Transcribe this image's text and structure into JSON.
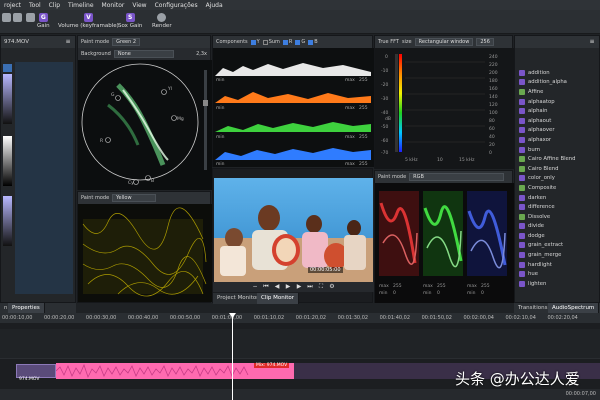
{
  "menu": [
    "roject",
    "Tool",
    "Clip",
    "Timeline",
    "Monitor",
    "View",
    "Configurações",
    "Ajuda"
  ],
  "toolbar": {
    "items": [
      {
        "label": "Gain",
        "badge": "G"
      },
      {
        "label": "Volume (keyframable)",
        "badge": "V"
      },
      {
        "label": "Sox Gain",
        "badge": "S"
      },
      {
        "label": "Render",
        "badge": ""
      }
    ]
  },
  "left_panel": {
    "title": "974.MOV",
    "tab_a": "n",
    "tab_b": "Properties"
  },
  "vectorscope": {
    "paint_mode_label": "Paint mode",
    "paint_mode_value": "Green 2",
    "background_label": "Background",
    "background_value": "None",
    "zoom": "2,3x",
    "targets": [
      "R",
      "Mg",
      "Yl",
      "B",
      "G",
      "Cy"
    ]
  },
  "waveform": {
    "paint_mode_label": "Paint mode",
    "paint_mode_value": "Yellow"
  },
  "histogram": {
    "title": "Components",
    "options": [
      {
        "label": "Y",
        "checked": true
      },
      {
        "label": "Sum",
        "checked": false
      },
      {
        "label": "R",
        "checked": true
      },
      {
        "label": "G",
        "checked": true
      },
      {
        "label": "B",
        "checked": true
      }
    ],
    "min_label": "min",
    "max_label": "max",
    "max_value": "255"
  },
  "fft": {
    "title": "True FFT",
    "size_label": "size",
    "window_value": "Rectangular window",
    "size_value": "256",
    "db_labels": [
      "0",
      "-10",
      "-20",
      "-30",
      "-40",
      "-50",
      "-60",
      "-70"
    ],
    "y_ticks": [
      "240",
      "220",
      "200",
      "180",
      "160",
      "140",
      "120",
      "100",
      "80",
      "60",
      "40",
      "20",
      "0"
    ],
    "freq_unit": "dB",
    "x_ticks": [
      "5 kHz",
      "10",
      "15 kHz"
    ]
  },
  "rgb_parade": {
    "paint_mode_label": "Paint mode",
    "paint_mode_value": "RGB",
    "min_label": "min",
    "max_label": "max",
    "values": [
      "255",
      "255",
      "255",
      "0",
      "0",
      "0"
    ]
  },
  "monitor": {
    "tab_project": "Project Monitor",
    "tab_clip": "Clip Monitor",
    "overlay_text": "00:00:05:00",
    "timecode": "00:00:01,00"
  },
  "effects": {
    "items": [
      {
        "name": "addition",
        "color": "#7a55c9"
      },
      {
        "name": "addition_alpha",
        "color": "#7a55c9"
      },
      {
        "name": "Affine",
        "color": "#6aa84f"
      },
      {
        "name": "alphaatop",
        "color": "#7a55c9"
      },
      {
        "name": "alphain",
        "color": "#7a55c9"
      },
      {
        "name": "alphaout",
        "color": "#7a55c9"
      },
      {
        "name": "alphaover",
        "color": "#7a55c9"
      },
      {
        "name": "alphaxor",
        "color": "#7a55c9"
      },
      {
        "name": "burn",
        "color": "#7a55c9"
      },
      {
        "name": "Cairo Affine Blend",
        "color": "#6aa84f"
      },
      {
        "name": "Cairo Blend",
        "color": "#6aa84f"
      },
      {
        "name": "color_only",
        "color": "#7a55c9"
      },
      {
        "name": "Composite",
        "color": "#6aa84f"
      },
      {
        "name": "darken",
        "color": "#7a55c9"
      },
      {
        "name": "difference",
        "color": "#7a55c9"
      },
      {
        "name": "Dissolve",
        "color": "#6aa84f"
      },
      {
        "name": "divide",
        "color": "#7a55c9"
      },
      {
        "name": "dodge",
        "color": "#7a55c9"
      },
      {
        "name": "grain_extract",
        "color": "#7a55c9"
      },
      {
        "name": "grain_merge",
        "color": "#7a55c9"
      },
      {
        "name": "hardlight",
        "color": "#7a55c9"
      },
      {
        "name": "hue",
        "color": "#7a55c9"
      },
      {
        "name": "lighten",
        "color": "#7a55c9"
      }
    ],
    "tab_transitions": "Transitions",
    "tab_audio": "AudioSpectrum"
  },
  "ruler": {
    "ticks": [
      "00:00:10,00",
      "00:00:20,00",
      "00:00:30,00",
      "00:00:40,00",
      "00:00:50,00",
      "00:01:00,00",
      "00:01:10,02",
      "00:01:20,02",
      "00:01:30,02",
      "00:01:40,02",
      "00:01:50,02",
      "00:02:00,04",
      "00:02:10,04",
      "00:02:20,04"
    ]
  },
  "timeline": {
    "clip_a_label": "974.MOV",
    "clip_b_label": "Mix: 974.MOV",
    "bottom_time": "00:00:07,00"
  },
  "watermark": "头条 @办公达人爱",
  "colors": {
    "accent": "#7a55c9",
    "clip_pink": "#ff6ab0",
    "playhead": "#ffffff"
  }
}
